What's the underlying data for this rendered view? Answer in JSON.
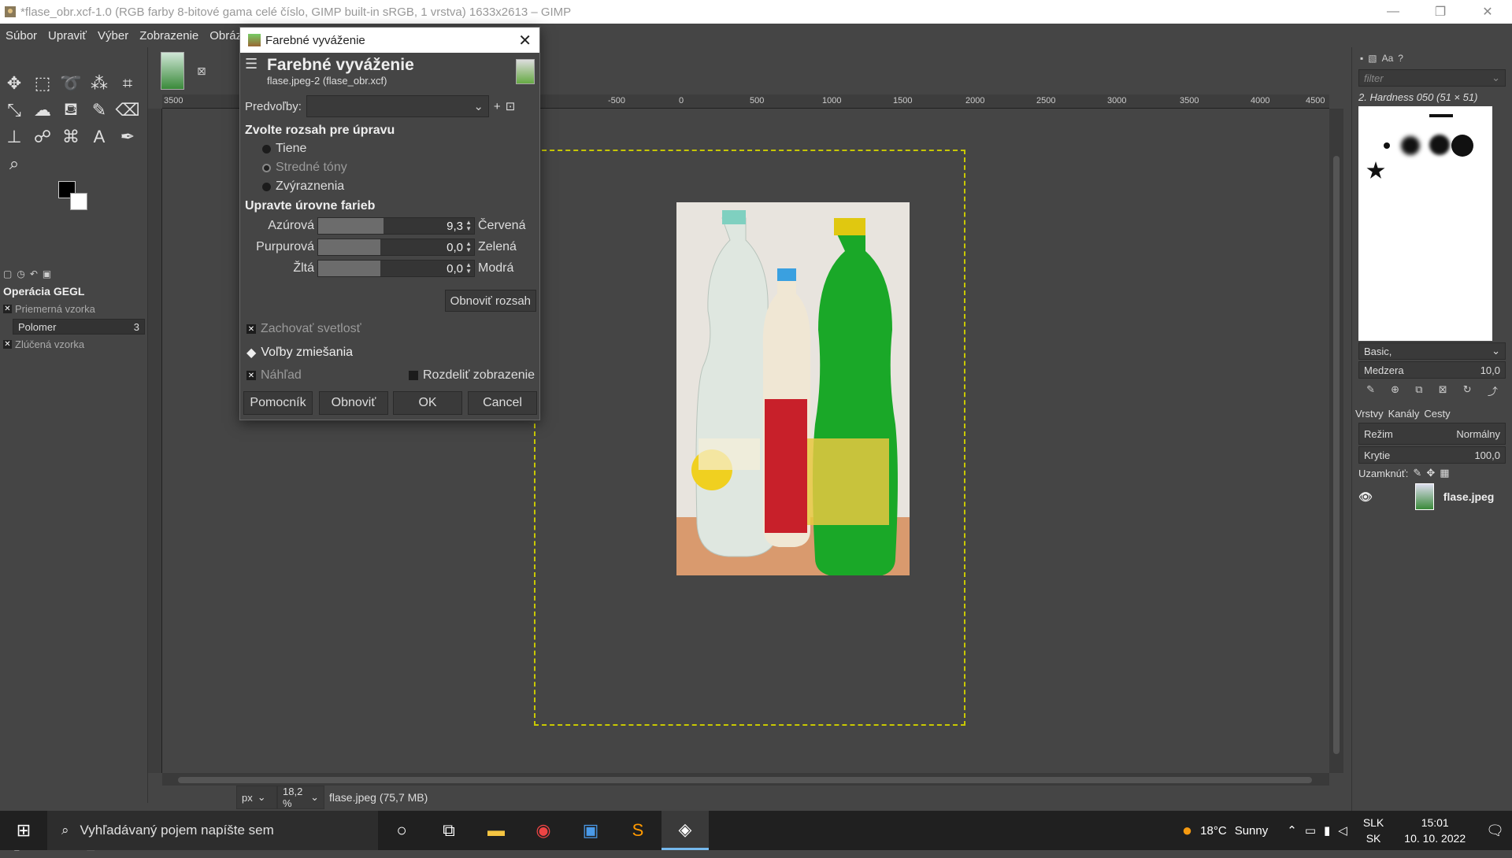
{
  "window": {
    "title": "*flase_obr.xcf-1.0 (RGB farby 8-bitové gama celé číslo, GIMP built-in sRGB, 1 vrstva) 1633x2613 – GIMP",
    "minimize": "—",
    "maximize": "❐",
    "close": "✕"
  },
  "menubar": {
    "items": [
      "Súbor",
      "Upraviť",
      "Výber",
      "Zobrazenie",
      "Obrázok"
    ]
  },
  "tool_options": {
    "title": "Operácia GEGL",
    "option1": "Priemerná vzorka",
    "radius_label": "Polomer",
    "radius_value": "3",
    "option2": "Zlúčená vzorka"
  },
  "ruler": {
    "labels": [
      "3500",
      "-500",
      "0",
      "500",
      "1000",
      "1500",
      "2000",
      "2500",
      "3000",
      "3500",
      "4000",
      "4500"
    ]
  },
  "status": {
    "unit": "px",
    "zoom": "18,2 %",
    "file_info": "flase.jpeg (75,7 MB)"
  },
  "right_dock": {
    "filter_placeholder": "filter",
    "brush_name": "2. Hardness 050 (51 × 51)",
    "brush_set": "Basic,",
    "spacing_label": "Medzera",
    "spacing_value": "10,0",
    "layer_tabs": [
      "Vrstvy",
      "Kanály",
      "Cesty"
    ],
    "mode_label": "Režim",
    "mode_value": "Normálny",
    "opacity_label": "Krytie",
    "opacity_value": "100,0",
    "lock_label": "Uzamknúť:",
    "layer_name": "flase.jpeg"
  },
  "dialog": {
    "window_title": "Farebné vyváženie",
    "heading": "Farebné vyváženie",
    "subheading": "flase.jpeg-2 (flase_obr.xcf)",
    "presets_label": "Predvoľby:",
    "range_title": "Zvolte rozsah pre úpravu",
    "ranges": [
      "Tiene",
      "Stredné tóny",
      "Zvýraznenia"
    ],
    "levels_title": "Upravte úrovne farieb",
    "sliders": [
      {
        "left": "Azúrová",
        "right": "Červená",
        "value": "9,3",
        "fraction": 0.52
      },
      {
        "left": "Purpurová",
        "right": "Zelená",
        "value": "0,0",
        "fraction": 0.5
      },
      {
        "left": "Žltá",
        "right": "Modrá",
        "value": "0,0",
        "fraction": 0.5
      }
    ],
    "reset_range": "Obnoviť rozsah",
    "preserve_luminosity": "Zachovať svetlosť",
    "blend_options": "Voľby zmiešania",
    "preview": "Náhľad",
    "split_view": "Rozdeliť zobrazenie",
    "buttons": {
      "help": "Pomocník",
      "reset": "Obnoviť",
      "ok": "OK",
      "cancel": "Cancel"
    }
  },
  "taskbar": {
    "search_placeholder": "Vyhľadávaný pojem napíšte sem",
    "weather_temp": "18°C",
    "weather_text": "Sunny",
    "lang_top": "SLK",
    "lang_bottom": "SK",
    "time": "15:01",
    "date": "10. 10. 2022"
  }
}
